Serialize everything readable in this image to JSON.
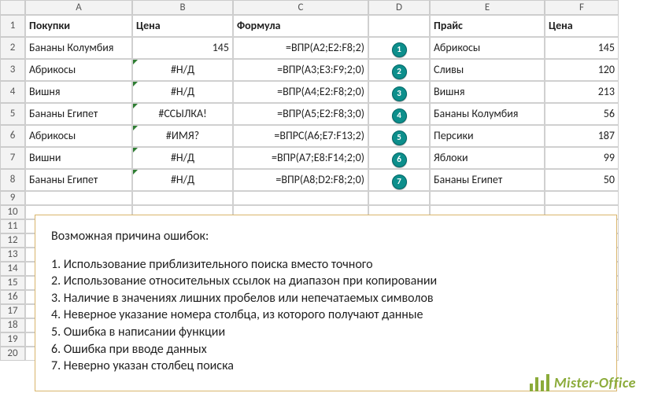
{
  "columns": [
    "A",
    "B",
    "C",
    "D",
    "E",
    "F"
  ],
  "header_row": [
    "Покупки",
    "Цена",
    "Формула",
    "",
    "Прайс",
    "Цена"
  ],
  "rows": [
    {
      "a": "Бананы Колумбия",
      "b": "145",
      "b_err": false,
      "b_right": true,
      "c": "=ВПР(A2;E2:F8;2)",
      "m": "1",
      "e": "Абрикосы",
      "f": "145"
    },
    {
      "a": "Абрикосы",
      "b": "#Н/Д",
      "b_err": true,
      "b_right": false,
      "c": "=ВПР(A3;E3:F9;2;0)",
      "m": "2",
      "e": "Сливы",
      "f": "120"
    },
    {
      "a": "Вишня",
      "b": "#Н/Д",
      "b_err": true,
      "b_right": false,
      "c": "=ВПР(A4;E2:F8;2;0)",
      "m": "3",
      "e": "Вишня",
      "f": "213"
    },
    {
      "a": "Бананы Египет",
      "b": "#ССЫЛКА!",
      "b_err": true,
      "b_right": false,
      "c": "=ВПР(A5;E2:F8;3;0)",
      "m": "4",
      "e": "Бананы Колумбия",
      "f": "56"
    },
    {
      "a": "Абрикосы",
      "b": "#ИМЯ?",
      "b_err": true,
      "b_right": false,
      "c": "=ВПРС(A6;E7:F13;2)",
      "m": "5",
      "e": "Персики",
      "f": "187"
    },
    {
      "a": "Вишни",
      "b": "#Н/Д",
      "b_err": true,
      "b_right": false,
      "c": "=ВПР(A7;E8:F14;2;0)",
      "m": "6",
      "e": "Яблоки",
      "f": "99"
    },
    {
      "a": "Бананы Египет",
      "b": "#Н/Д",
      "b_err": true,
      "b_right": false,
      "c": "=ВПР(A8;D2:F8;2;0)",
      "m": "7",
      "e": "Бананы Египет",
      "f": "50"
    }
  ],
  "blank_rows": [
    "9",
    "10",
    "11",
    "12",
    "13",
    "14",
    "15",
    "16",
    "17",
    "18",
    "19",
    "20"
  ],
  "textbox": {
    "title": "Возможная причина ошибок:",
    "items": [
      "1. Использование приблизительного поиска вместо точного",
      "2. Использование относительных ссылок на диапазон при копировании",
      "3. Наличие в значениях лишних пробелов или непечатаемых символов",
      "4. Неверное указание номера столбца, из которого получают данные",
      "5. Ошибка в написании функции",
      "6. Ошибка при вводе данных",
      "7. Неверно указан столбец поиска"
    ]
  },
  "logo": "Mister-Office"
}
